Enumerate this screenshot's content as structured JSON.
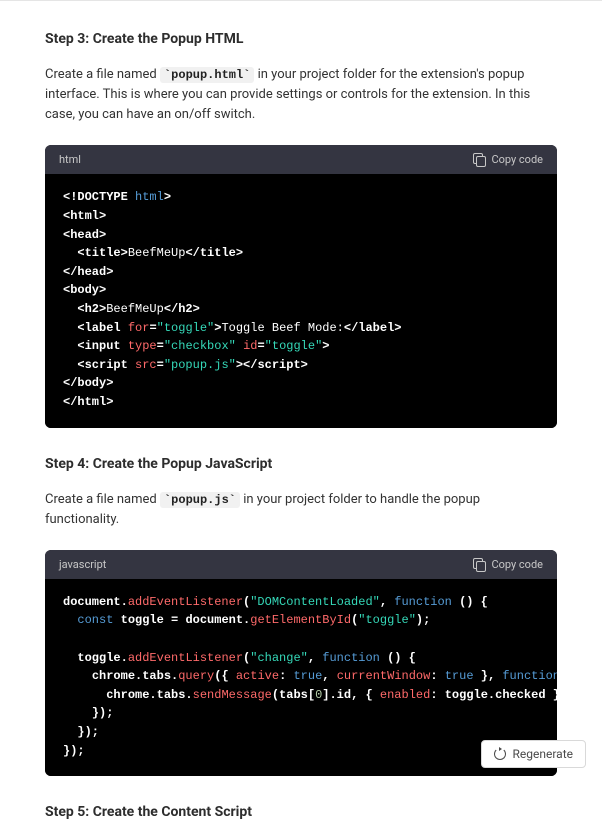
{
  "step3": {
    "heading": "Step 3: Create the Popup HTML",
    "desc_a": "Create a file named ",
    "filename": "popup.html",
    "desc_b": " in your project folder for the extension's popup interface. This is where you can provide settings or controls for the extension. In this case, you can have an on/off switch."
  },
  "code1": {
    "lang": "html",
    "copy": "Copy code",
    "tokens": {
      "doctype": "html",
      "title_text": "BeefMeUp",
      "h2_text": "BeefMeUp",
      "label_for": "\"toggle\"",
      "label_text": "Toggle Beef Mode:",
      "input_type": "\"checkbox\"",
      "input_id": "\"toggle\"",
      "script_src": "\"popup.js\""
    }
  },
  "step4": {
    "heading": "Step 4: Create the Popup JavaScript",
    "desc_a": "Create a file named ",
    "filename": "popup.js",
    "desc_b": " in your project folder to handle the popup functionality."
  },
  "code2": {
    "lang": "javascript",
    "copy": "Copy code",
    "tokens": {
      "str_domloaded": "\"DOMContentLoaded\"",
      "kw_function": "function",
      "kw_const": "const",
      "id_toggle": "\"toggle\"",
      "str_change": "\"change\"",
      "bool_true1": "true",
      "bool_true2": "true",
      "id_active": "active",
      "id_currentWindow": "currentWindow",
      "id_enabled": "enabled",
      "num_zero": "0"
    }
  },
  "step5": {
    "heading": "Step 5: Create the Content Script"
  },
  "regenerate": "Regenerate"
}
